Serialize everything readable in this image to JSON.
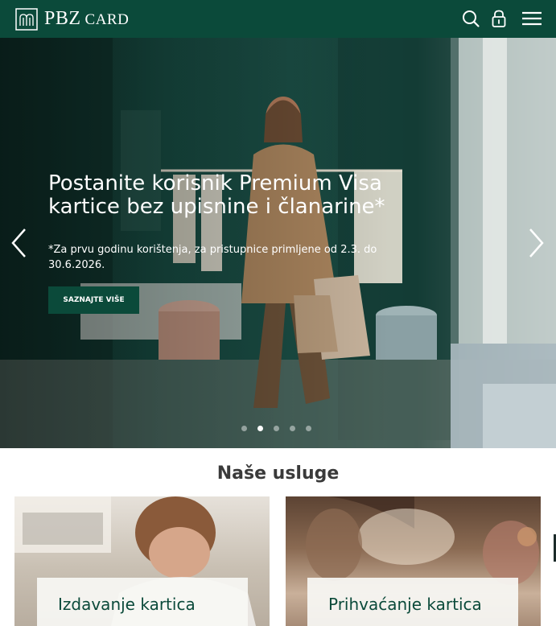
{
  "header": {
    "logo_main": "PBZ",
    "logo_sub": "CARD",
    "icons": [
      "search-icon",
      "lock-icon",
      "menu-icon"
    ],
    "background": "#0b4a3a"
  },
  "hero": {
    "title": "Postanite korisnik Premium Visa kartice bez upisnine i članarine*",
    "note": "*Za prvu godinu korištenja, za pristupnice primljene od 2.3. do 30.6.2026.",
    "button_label": "SAZNAJTE VIŠE",
    "slides_count": 5,
    "active_slide": 2,
    "prev_icon": "chevron-left-icon",
    "next_icon": "chevron-right-icon"
  },
  "services": {
    "title": "Naše usluge",
    "cards": [
      {
        "label": "Izdavanje kartica"
      },
      {
        "label": "Prihvaćanje kartica"
      }
    ]
  },
  "colors": {
    "brand_green": "#0b4a3a",
    "text_dark": "#3a3a3a"
  }
}
